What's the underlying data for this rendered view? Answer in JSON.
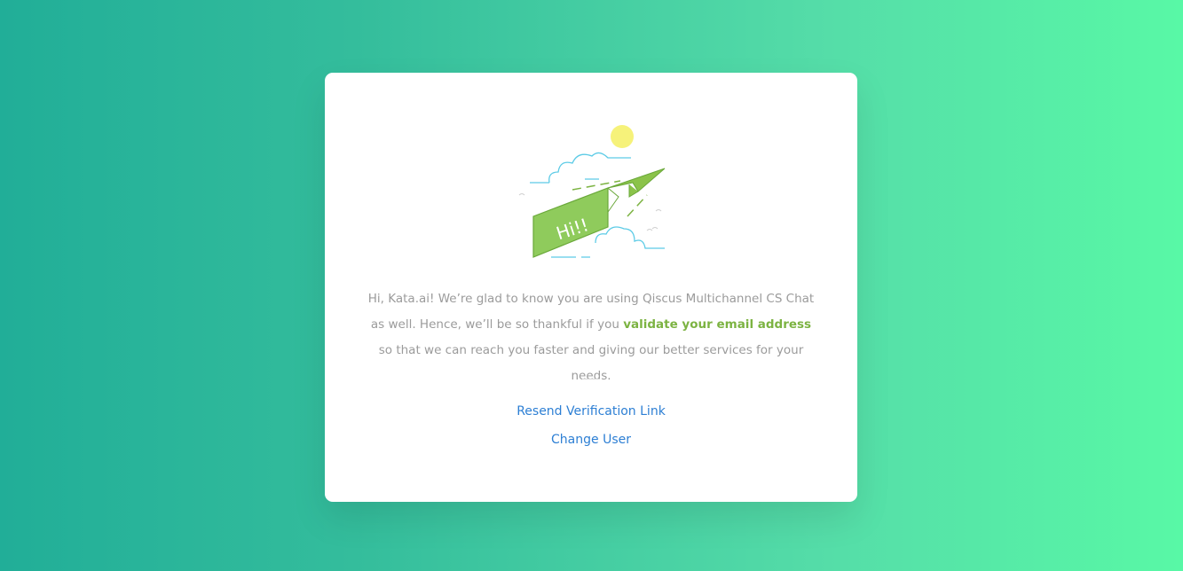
{
  "card": {
    "illustration_banner_text": "Hi!!",
    "message": {
      "part1": "Hi, Kata.ai! We’re glad to know you are using Qiscus Multichannel CS Chat as well. Hence, we’ll be so thankful if you ",
      "highlight": "validate your email address",
      "part2": " so that we can reach you faster and giving our better services for your needs."
    },
    "resend_link": "Resend Verification Link",
    "change_user_link": "Change User"
  },
  "colors": {
    "background_start": "#21ae98",
    "background_end": "#58f8a6",
    "highlight": "#7cb342",
    "link": "#2d7fd4",
    "text": "#9b9b9b"
  }
}
